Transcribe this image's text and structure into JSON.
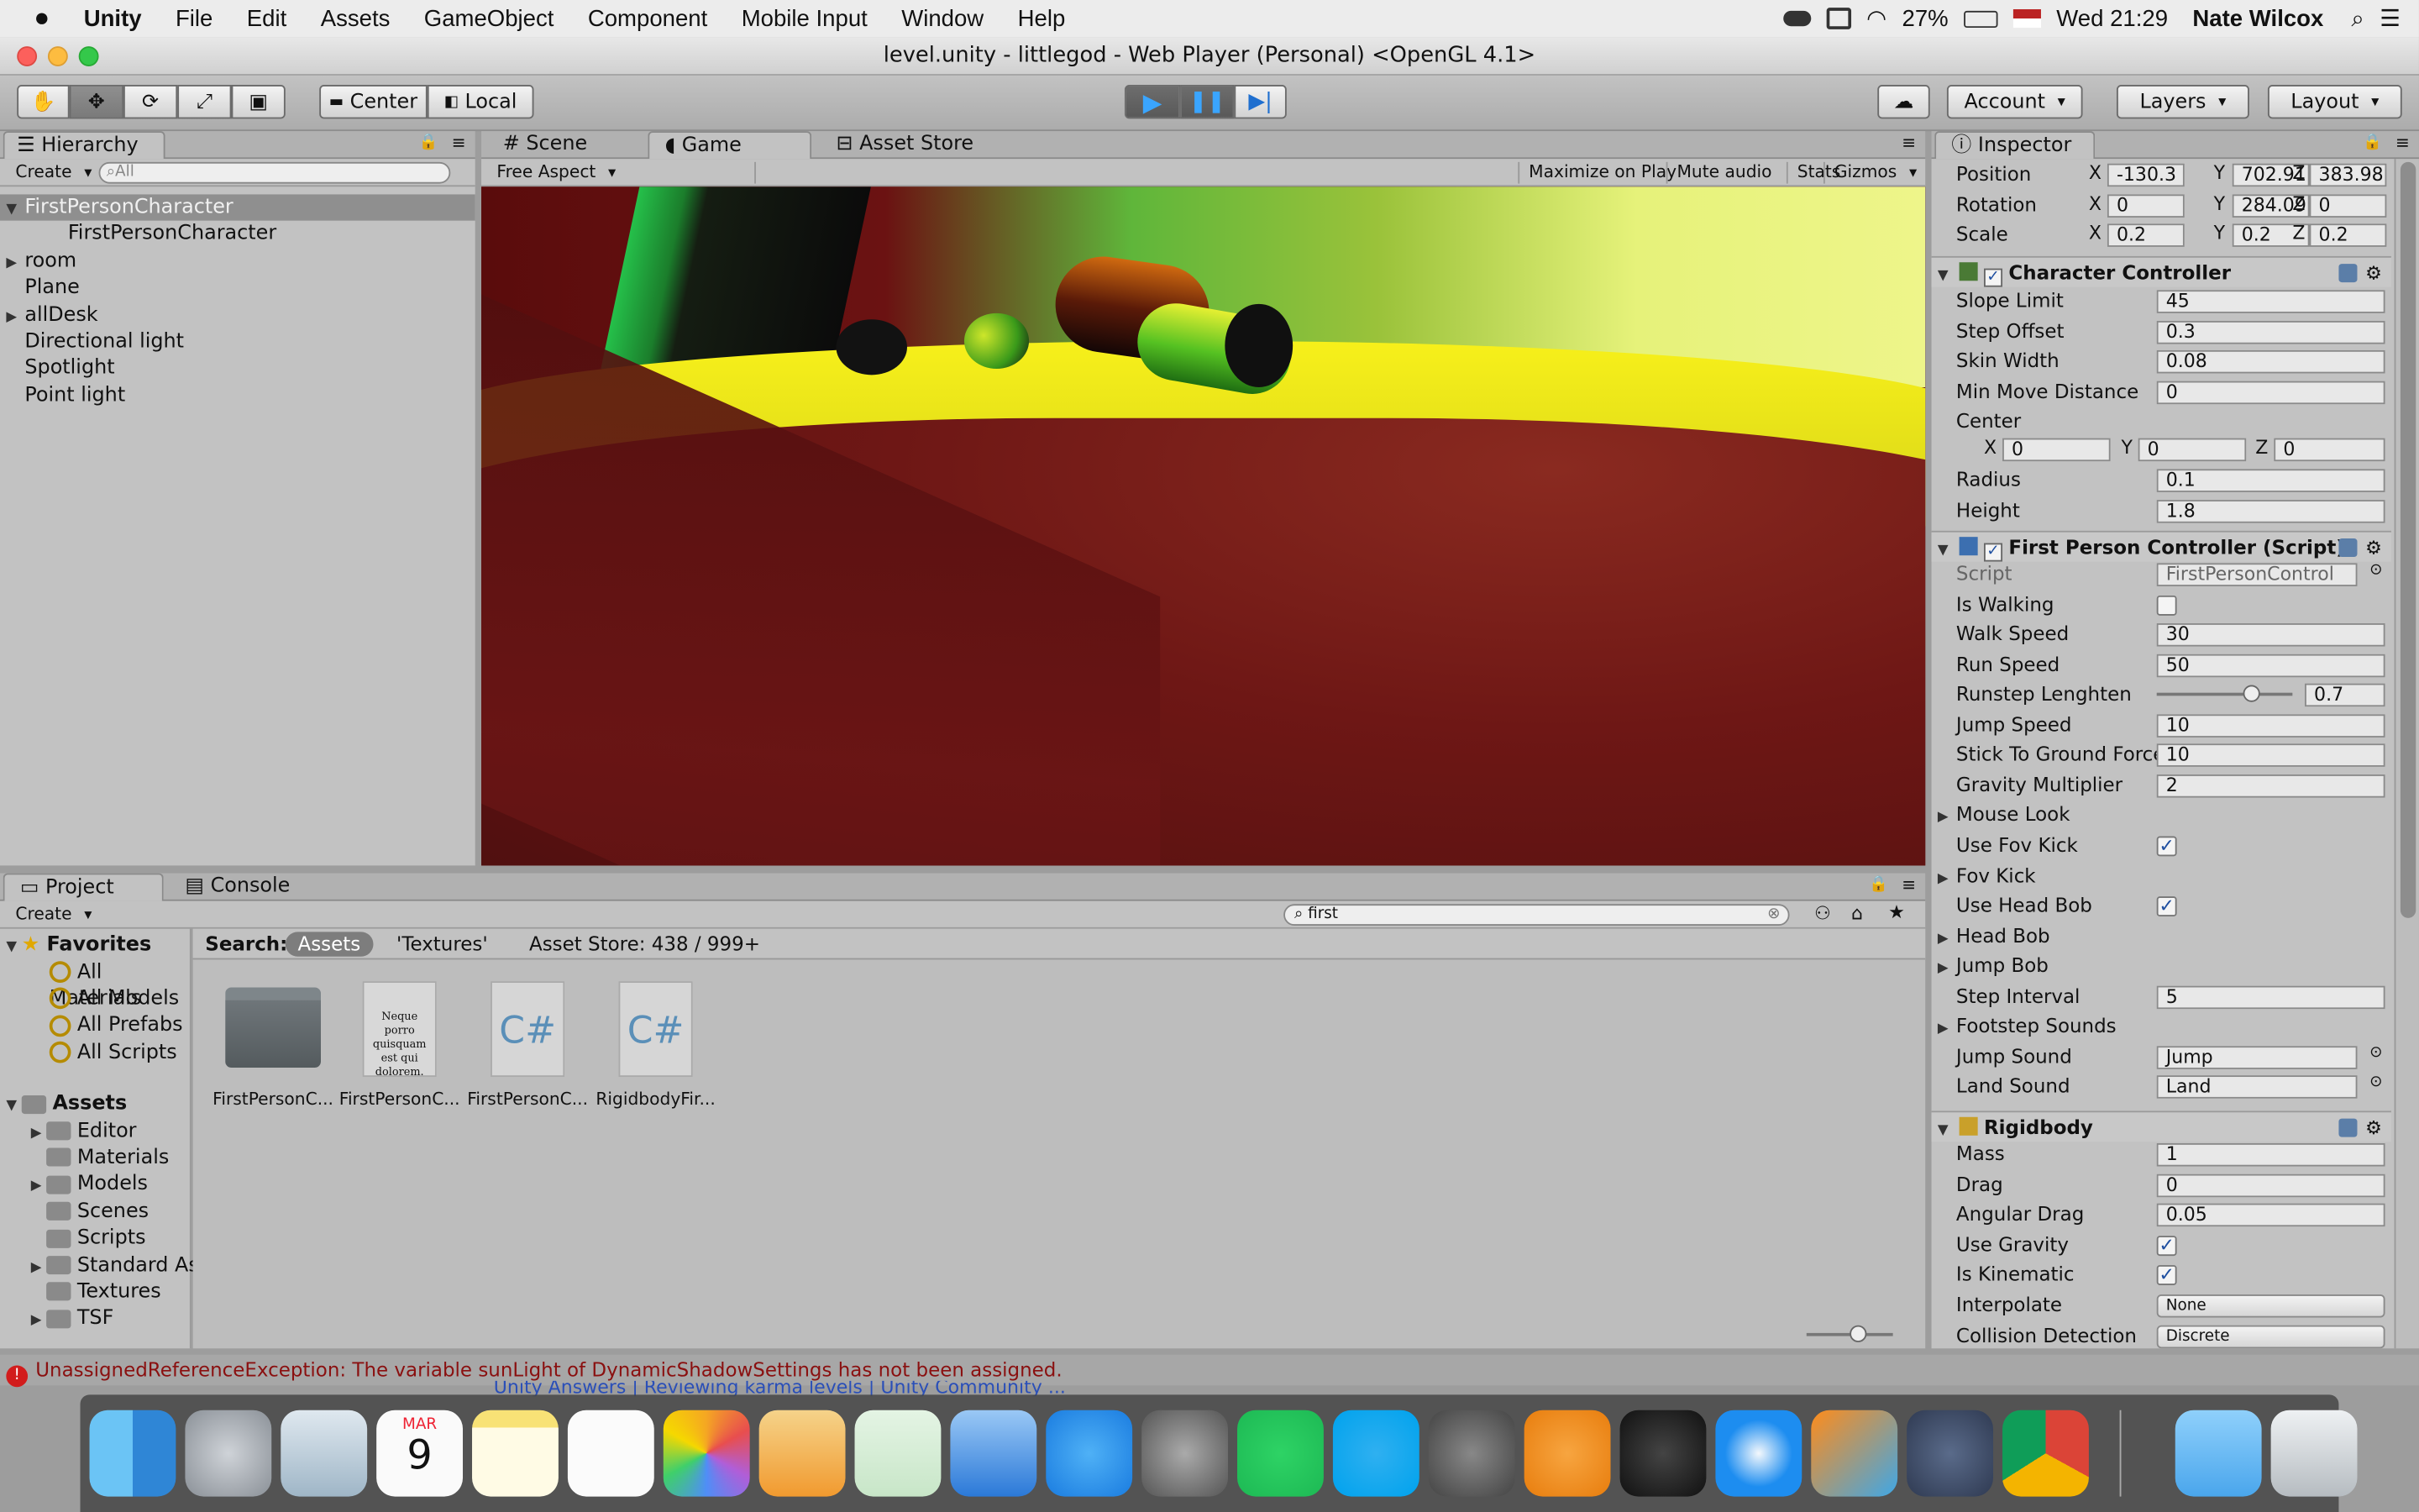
{
  "menubar": {
    "apple": "",
    "app": "Unity",
    "items": [
      "File",
      "Edit",
      "Assets",
      "GameObject",
      "Component",
      "Mobile Input",
      "Window",
      "Help"
    ],
    "battery": "27%",
    "clock": "Wed 21:29",
    "user": "Nate Wilcox"
  },
  "window": {
    "title": "level.unity - littlegod - Web Player (Personal) <OpenGL 4.1>"
  },
  "toolbar": {
    "center": "Center",
    "local": "Local",
    "account": "Account",
    "layers": "Layers",
    "layout": "Layout"
  },
  "hierarchy": {
    "tab": "Hierarchy",
    "create": "Create",
    "search": "All",
    "items": [
      {
        "label": "FirstPersonCharacter",
        "expand": "▼",
        "selected": true
      },
      {
        "label": "FirstPersonCharacter",
        "expand": "",
        "indent": true
      },
      {
        "label": "room",
        "expand": "▶"
      },
      {
        "label": "Plane",
        "expand": ""
      },
      {
        "label": "allDesk",
        "expand": "▶"
      },
      {
        "label": "Directional light",
        "expand": ""
      },
      {
        "label": "Spotlight",
        "expand": ""
      },
      {
        "label": "Point light",
        "expand": ""
      }
    ]
  },
  "center": {
    "tabs": [
      "Scene",
      "Game",
      "Asset Store"
    ],
    "aspect": "Free Aspect",
    "opts": [
      "Maximize on Play",
      "Mute audio",
      "Stats",
      "Gizmos"
    ]
  },
  "project": {
    "tabs": [
      "Project",
      "Console"
    ],
    "create": "Create",
    "search": "first",
    "favorites_label": "Favorites",
    "favorites": [
      "All Materials",
      "All Models",
      "All Prefabs",
      "All Scripts"
    ],
    "assets_label": "Assets",
    "folders": [
      "Editor",
      "Materials",
      "Models",
      "Scenes",
      "Scripts",
      "Standard Ass",
      "Textures",
      "TSF"
    ],
    "search_label": "Search:",
    "scope_assets": "Assets",
    "scope_textures": "'Textures'",
    "store": "Asset Store: 438 / 999+",
    "files": [
      {
        "name": "FirstPersonC...",
        "kind": "folder"
      },
      {
        "name": "FirstPersonC...",
        "kind": "text",
        "preview": "Neque porro quisquam est qui dolorem."
      },
      {
        "name": "FirstPersonC...",
        "kind": "cs"
      },
      {
        "name": "RigidbodyFir...",
        "kind": "cs"
      }
    ]
  },
  "inspector": {
    "tab": "Inspector",
    "transform": [
      {
        "label": "Position",
        "x": "-130.3",
        "y": "702.91",
        "z": "383.98"
      },
      {
        "label": "Rotation",
        "x": "0",
        "y": "284.09",
        "z": "0"
      },
      {
        "label": "Scale",
        "x": "0.2",
        "y": "0.2",
        "z": "0.2"
      }
    ],
    "cc": {
      "title": "Character Controller",
      "rows": [
        {
          "label": "Slope Limit",
          "value": "45"
        },
        {
          "label": "Step Offset",
          "value": "0.3"
        },
        {
          "label": "Skin Width",
          "value": "0.08"
        },
        {
          "label": "Min Move Distance",
          "value": "0"
        }
      ],
      "center_label": "Center",
      "center": {
        "x": "0",
        "y": "0",
        "z": "0"
      },
      "rows2": [
        {
          "label": "Radius",
          "value": "0.1"
        },
        {
          "label": "Height",
          "value": "1.8"
        }
      ]
    },
    "fpc": {
      "title": "First Person Controller (Script)",
      "script_label": "Script",
      "script": "FirstPersonControl",
      "is_walking": "Is Walking",
      "walk_label": "Walk Speed",
      "walk": "30",
      "run_label": "Run Speed",
      "run": "50",
      "runstep_label": "Runstep Lenghten",
      "runstep": "0.7",
      "jump_label": "Jump Speed",
      "jump": "10",
      "stick_label": "Stick To Ground Force",
      "stick": "10",
      "grav_label": "Gravity Multiplier",
      "grav": "2",
      "mouse": "Mouse Look",
      "fovkick_use": "Use Fov Kick",
      "fovkick": "Fov Kick",
      "headbob_use": "Use Head Bob",
      "headbob": "Head Bob",
      "jumpbob": "Jump Bob",
      "step_label": "Step Interval",
      "step": "5",
      "footstep": "Footstep Sounds",
      "jsound_label": "Jump Sound",
      "jsound": "Jump",
      "lsound_label": "Land Sound",
      "lsound": "Land"
    },
    "rb": {
      "title": "Rigidbody",
      "mass_label": "Mass",
      "mass": "1",
      "drag_label": "Drag",
      "drag": "0",
      "adrag_label": "Angular Drag",
      "adrag": "0.05",
      "grav_label": "Use Gravity",
      "kin_label": "Is Kinematic",
      "interp_label": "Interpolate",
      "interp": "None",
      "coll_label": "Collision Detection",
      "coll": "Discrete"
    }
  },
  "status": {
    "error": "UnassignedReferenceException: The variable sunLight of DynamicShadowSettings has not been assigned."
  },
  "calendar": {
    "month": "MAR",
    "day": "9"
  },
  "behind_text": "Unity Answers | Reviewing karma levels | Unity Community ..."
}
